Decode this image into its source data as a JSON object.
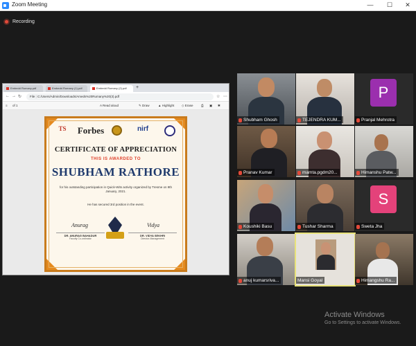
{
  "window": {
    "title": "Zoom Meeting",
    "controls": {
      "minimize": "—",
      "maximize": "☐",
      "close": "✕"
    }
  },
  "recording": {
    "label": "Recording"
  },
  "shared_screen": {
    "tabs": [
      {
        "label": "Embedd Rumany.pdf",
        "active": false
      },
      {
        "label": "Embedd Rumany (1).pdf",
        "active": false
      },
      {
        "label": "Embedd Rumany (2).pdf",
        "active": true
      },
      {
        "label": "+",
        "active": false
      }
    ],
    "address": {
      "prefix": "File",
      "url": "C:/Users/Admin/Downloads/Ameds%20Rumany%20(3).pdf"
    },
    "pdf_toolbar": {
      "page": "of 1",
      "read_aloud": "Read aloud",
      "draw": "Draw",
      "highlight": "Highlight",
      "erase": "Erase"
    },
    "certificate": {
      "logos": {
        "ts_mark": "TS",
        "forbes": "Forbes",
        "nirf": "nirf"
      },
      "title": "CERTIFICATE OF APPRECIATION",
      "awarded_to": "THIS IS AWARDED TO",
      "recipient": "SHUBHAM RATHORE",
      "description": "for his outstanding participation in Quick-Wits activity organized by Tresme on 9th January, 2021.",
      "position_text": "He has secured 3rd position in the event.",
      "signature_left": "Anurag",
      "signature_right": "Vidya",
      "signer_left": {
        "name": "DR. ANURAG BAHADUR",
        "role": "Faculty Co-ordinator"
      },
      "signer_right": {
        "name": "DR. VIDYA SEKHRI",
        "role": "Director-Management"
      }
    }
  },
  "participants": [
    {
      "name": "Shubham Ghosh",
      "muted": true,
      "type": "video"
    },
    {
      "name": "TEJENDRA KUM...",
      "muted": true,
      "type": "video"
    },
    {
      "name": "Pranjal Mehrotra",
      "muted": true,
      "type": "avatar",
      "letter": "P",
      "color": "#9b2fae"
    },
    {
      "name": "Pranav Kumar",
      "muted": true,
      "type": "video"
    },
    {
      "name": "mamta.pgdm20...",
      "muted": true,
      "type": "video"
    },
    {
      "name": "Himanshu Patw...",
      "muted": true,
      "type": "video"
    },
    {
      "name": "Koushiki Basu",
      "muted": true,
      "type": "video"
    },
    {
      "name": "Tushar Sharma",
      "muted": true,
      "type": "video"
    },
    {
      "name": "Sweta Jha",
      "muted": true,
      "type": "avatar",
      "letter": "S",
      "color": "#e4427a"
    },
    {
      "name": "anuj kumarsriva...",
      "muted": true,
      "type": "video"
    },
    {
      "name": "Mansi Goyal",
      "muted": false,
      "type": "video",
      "active_speaker": true
    },
    {
      "name": "Himangshu Ra...",
      "muted": true,
      "type": "video"
    }
  ],
  "watermark": {
    "line1": "Activate Windows",
    "line2": "Go to Settings to activate Windows."
  }
}
